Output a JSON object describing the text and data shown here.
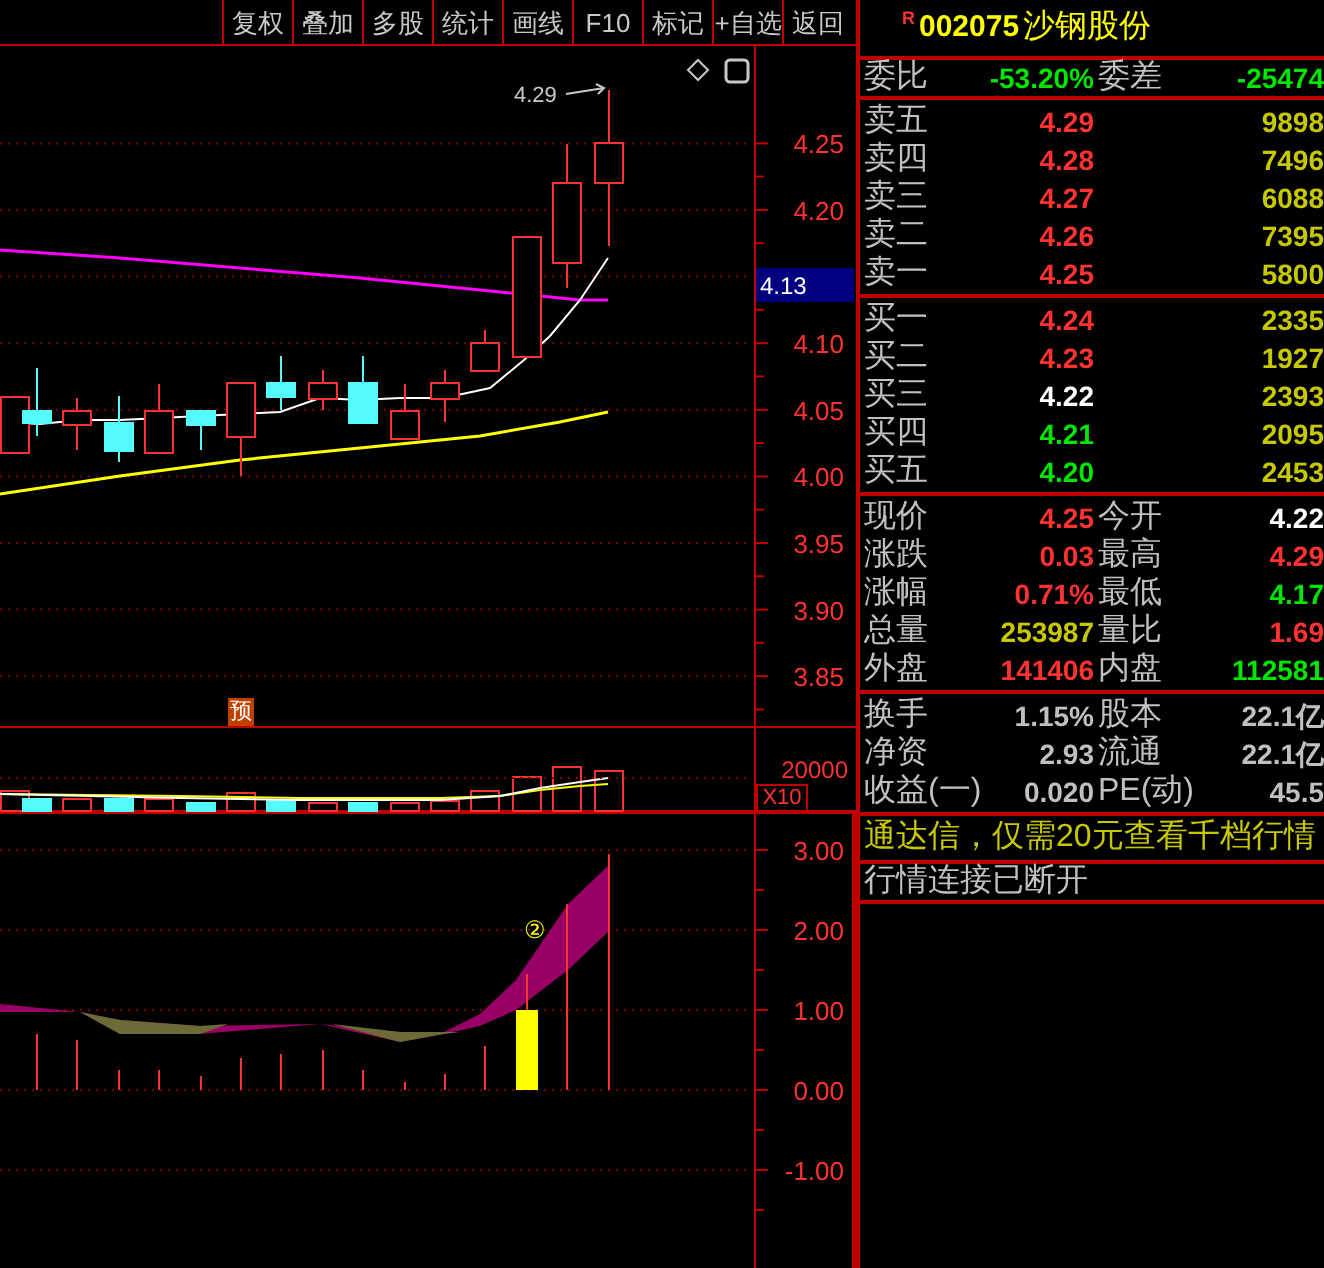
{
  "toolbar": {
    "buttons": [
      "复权",
      "叠加",
      "多股",
      "统计",
      "画线",
      "F10",
      "标记",
      "+自选",
      "返回"
    ]
  },
  "price_chart": {
    "high_label": "4.29",
    "price_ticks": [
      "4.25",
      "4.20",
      "4.10",
      "4.05",
      "4.00",
      "3.95",
      "3.90",
      "3.85"
    ],
    "current_price_tag": "4.13",
    "forecast_badge": "预"
  },
  "volume_chart": {
    "tick": "20000",
    "scale_button": "X10"
  },
  "indicator_chart": {
    "signal_marker": "②",
    "ticks": [
      "3.00",
      "2.00",
      "1.00",
      "0.00",
      "-1.00"
    ]
  },
  "quote": {
    "flag": "R",
    "code": "002075",
    "name": "沙钢股份",
    "order_ratio": [
      {
        "label": "委比",
        "value": "-53.20%",
        "color": "#00e600"
      },
      {
        "label": "委差",
        "value": "-25474",
        "color": "#00e600"
      }
    ],
    "asks": [
      {
        "label": "卖五",
        "price": "4.29",
        "color": "#ff3232",
        "volume": "9898"
      },
      {
        "label": "卖四",
        "price": "4.28",
        "color": "#ff3232",
        "volume": "7496"
      },
      {
        "label": "卖三",
        "price": "4.27",
        "color": "#ff3232",
        "volume": "6088"
      },
      {
        "label": "卖二",
        "price": "4.26",
        "color": "#ff3232",
        "volume": "7395"
      },
      {
        "label": "卖一",
        "price": "4.25",
        "color": "#ff3232",
        "volume": "5800"
      }
    ],
    "bids": [
      {
        "label": "买一",
        "price": "4.24",
        "color": "#ff3232",
        "volume": "2335"
      },
      {
        "label": "买二",
        "price": "4.23",
        "color": "#ff3232",
        "volume": "1927"
      },
      {
        "label": "买三",
        "price": "4.22",
        "color": "#ffffff",
        "volume": "2393"
      },
      {
        "label": "买四",
        "price": "4.21",
        "color": "#00e600",
        "volume": "2095"
      },
      {
        "label": "买五",
        "price": "4.20",
        "color": "#00e600",
        "volume": "2453"
      }
    ],
    "stats": [
      [
        {
          "label": "现价",
          "value": "4.25",
          "color": "#ff3232"
        },
        {
          "label": "今开",
          "value": "4.22",
          "color": "#ffffff"
        }
      ],
      [
        {
          "label": "涨跌",
          "value": "0.03",
          "color": "#ff3232"
        },
        {
          "label": "最高",
          "value": "4.29",
          "color": "#ff3232"
        }
      ],
      [
        {
          "label": "涨幅",
          "value": "0.71%",
          "color": "#ff3232"
        },
        {
          "label": "最低",
          "value": "4.17",
          "color": "#00e600"
        }
      ],
      [
        {
          "label": "总量",
          "value": "253987",
          "color": "#c8c800"
        },
        {
          "label": "量比",
          "value": "1.69",
          "color": "#ff3232"
        }
      ],
      [
        {
          "label": "外盘",
          "value": "141406",
          "color": "#ff3232"
        },
        {
          "label": "内盘",
          "value": "112581",
          "color": "#00e600"
        }
      ]
    ],
    "fundamentals": [
      [
        {
          "label": "换手",
          "value": "1.15%",
          "color": "#c0c0c0"
        },
        {
          "label": "股本",
          "value": "22.1亿",
          "color": "#c0c0c0"
        }
      ],
      [
        {
          "label": "净资",
          "value": "2.93",
          "color": "#c0c0c0"
        },
        {
          "label": "流通",
          "value": "22.1亿",
          "color": "#c0c0c0"
        }
      ],
      [
        {
          "label": "收益(一)",
          "value": "0.020",
          "color": "#c0c0c0"
        },
        {
          "label": "PE(动)",
          "value": "45.5",
          "color": "#c0c0c0"
        }
      ]
    ],
    "promo": "通达信，仅需20元查看千档行情",
    "status": "行情连接已断开"
  }
}
